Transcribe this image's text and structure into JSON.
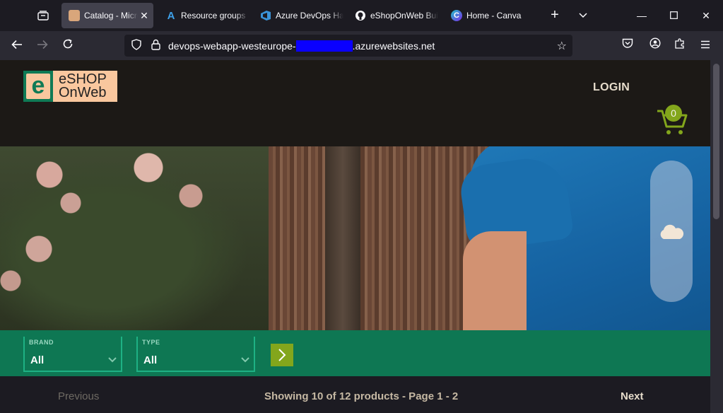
{
  "browser": {
    "tabs": [
      {
        "label": "Catalog - Microsoft eShopOnWeb",
        "icon": "catalog-favicon",
        "active": true
      },
      {
        "label": "Resource groups - Microsoft Azure",
        "icon": "azure-favicon",
        "active": false
      },
      {
        "label": "Azure DevOps Hands-on Labs",
        "icon": "devops-favicon",
        "active": false
      },
      {
        "label": "eShopOnWeb Build",
        "icon": "github-favicon",
        "active": false
      },
      {
        "label": "Home - Canva",
        "icon": "canva-favicon",
        "active": false
      }
    ],
    "url_prefix": "devops-webapp-westeurope-",
    "url_suffix": ".azurewebsites.net"
  },
  "site": {
    "logo_line1": "eSHOP",
    "logo_line2": "OnWeb",
    "logo_letter": "e",
    "login_label": "LOGIN",
    "cart_count": "0"
  },
  "filters": {
    "brand_label": "BRAND",
    "brand_value": "All",
    "type_label": "TYPE",
    "type_value": "All"
  },
  "pager": {
    "previous_label": "Previous",
    "info": "Showing 10 of 12 products - Page 1 - 2",
    "next_label": "Next"
  },
  "colors": {
    "filter_bar": "#0e7753",
    "accent_green": "#83a61c",
    "logo_bg": "#f9c79e"
  }
}
